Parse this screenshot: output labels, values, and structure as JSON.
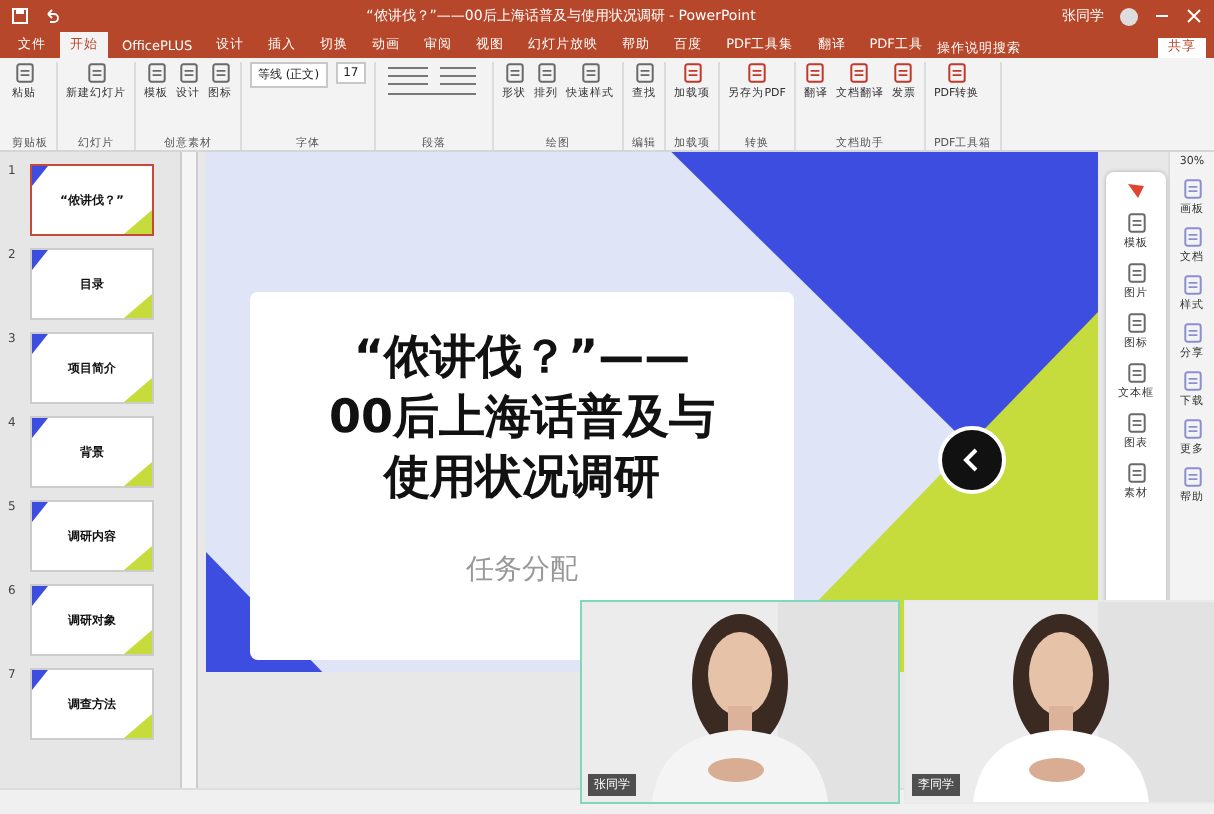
{
  "window": {
    "title": "“侬讲伐？”——00后上海话普及与使用状况调研 - PowerPoint",
    "user": "张同学"
  },
  "tabs": [
    {
      "label": "文件",
      "selected": false
    },
    {
      "label": "开始",
      "selected": true
    },
    {
      "label": "OfficePLUS",
      "selected": false
    },
    {
      "label": "设计",
      "selected": false
    },
    {
      "label": "插入",
      "selected": false
    },
    {
      "label": "切换",
      "selected": false
    },
    {
      "label": "动画",
      "selected": false
    },
    {
      "label": "审阅",
      "selected": false
    },
    {
      "label": "视图",
      "selected": false
    },
    {
      "label": "幻灯片放映",
      "selected": false
    },
    {
      "label": "帮助",
      "selected": false
    },
    {
      "label": "百度",
      "selected": false
    },
    {
      "label": "PDF工具集",
      "selected": false
    },
    {
      "label": "翻译",
      "selected": false
    },
    {
      "label": "PDF工具",
      "selected": false
    }
  ],
  "search": {
    "placeholder": "操作说明搜索"
  },
  "share_button": "共享",
  "ribbon": {
    "font_name": "等线 (正文)",
    "font_size": "17",
    "groups": [
      {
        "label": "剪贴板",
        "buttons": [
          "粘贴"
        ]
      },
      {
        "label": "幻灯片",
        "buttons": [
          "新建幻灯片"
        ]
      },
      {
        "label": "创意素材",
        "buttons": [
          "模板",
          "设计",
          "图标"
        ]
      },
      {
        "label": "字体"
      },
      {
        "label": "段落"
      },
      {
        "label": "绘图",
        "buttons": [
          "形状",
          "排列",
          "快速样式"
        ]
      },
      {
        "label": "编辑",
        "buttons": [
          "查找"
        ]
      },
      {
        "label": "加载项",
        "buttons": [
          "加载项"
        ]
      },
      {
        "label": "转换",
        "buttons": [
          "另存为PDF"
        ]
      },
      {
        "label": "文档助手",
        "buttons": [
          "翻译",
          "文档翻译",
          "发票"
        ]
      },
      {
        "label": "PDF工具箱",
        "buttons": [
          "PDF转换"
        ]
      }
    ]
  },
  "slides": [
    {
      "number": "1",
      "selected": true,
      "title": "“侬讲伐？”"
    },
    {
      "number": "2",
      "selected": false,
      "title": "目录"
    },
    {
      "number": "3",
      "selected": false,
      "title": "项目简介"
    },
    {
      "number": "4",
      "selected": false,
      "title": "背景"
    },
    {
      "number": "5",
      "selected": false,
      "title": "调研内容"
    },
    {
      "number": "6",
      "selected": false,
      "title": "调研对象"
    },
    {
      "number": "7",
      "selected": false,
      "title": "调查方法"
    }
  ],
  "slide": {
    "title_lines": [
      "“侬讲伐？”——",
      "00后上海话普及与",
      "使用状况调研"
    ],
    "subtitle": "任务分配"
  },
  "float_toolbar": [
    "模板",
    "图片",
    "图标",
    "文本框",
    "图表",
    "素材"
  ],
  "side_panel": {
    "zoom": "30%",
    "items": [
      "画板",
      "文档",
      "样式",
      "分享",
      "下载",
      "更多",
      "帮助"
    ]
  },
  "videos": [
    {
      "name": "张同学",
      "speaking": true
    },
    {
      "name": "李同学",
      "speaking": false
    }
  ]
}
